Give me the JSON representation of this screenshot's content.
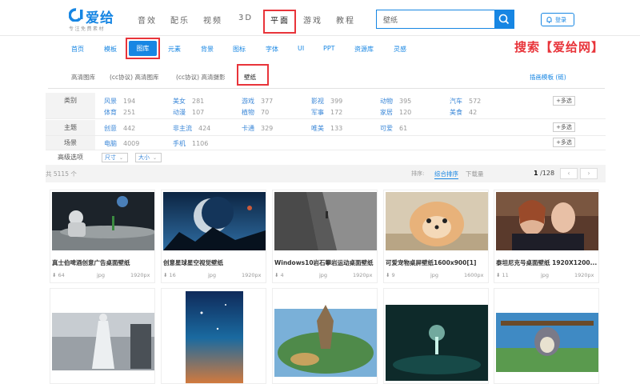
{
  "logo": {
    "text": "爱给",
    "subtitle": "专注免费素材"
  },
  "top_nav": [
    "音效",
    "配乐",
    "视频",
    "3D",
    "平面",
    "游戏",
    "教程"
  ],
  "search": {
    "value": "壁纸"
  },
  "login": {
    "label": "登录"
  },
  "sub_nav": [
    "首页",
    "模板",
    "图库",
    "元素",
    "背景",
    "图标",
    "字体",
    "UI",
    "PPT",
    "资源库",
    "灵感"
  ],
  "promo": "搜索【爱给网】",
  "tabs": [
    "高清图库",
    "(cc协议) 高清图库",
    "(cc协议) 高清摄影",
    "壁纸"
  ],
  "tab_right_link": "插画模板 (链)",
  "filters": {
    "category": {
      "label": "类别",
      "row1": [
        {
          "name": "风景",
          "count": "194"
        },
        {
          "name": "美女",
          "count": "281"
        },
        {
          "name": "游戏",
          "count": "377"
        },
        {
          "name": "影视",
          "count": "399"
        },
        {
          "name": "动物",
          "count": "395"
        },
        {
          "name": "汽车",
          "count": "572"
        }
      ],
      "row2": [
        {
          "name": "体育",
          "count": "251"
        },
        {
          "name": "动漫",
          "count": "107"
        },
        {
          "name": "植物",
          "count": "70"
        },
        {
          "name": "军事",
          "count": "172"
        },
        {
          "name": "家居",
          "count": "120"
        },
        {
          "name": "美食",
          "count": "42"
        }
      ],
      "more": "+多选"
    },
    "theme": {
      "label": "主题",
      "items": [
        {
          "name": "创意",
          "count": "442"
        },
        {
          "name": "非主流",
          "count": "424"
        },
        {
          "name": "卡通",
          "count": "329"
        },
        {
          "name": "唯美",
          "count": "133"
        },
        {
          "name": "可爱",
          "count": "61"
        }
      ],
      "more": "+多选"
    },
    "scene": {
      "label": "场景",
      "items": [
        {
          "name": "电脑",
          "count": "4009"
        },
        {
          "name": "手机",
          "count": "1106"
        }
      ],
      "more": "+多选"
    },
    "advanced": {
      "label": "高级选项",
      "size": "尺寸",
      "scale": "大小"
    }
  },
  "results": {
    "count": "共 5115 个",
    "sort_label": "排序:",
    "sort_active": "综合排序",
    "sort_other": "下载量",
    "page_current": "1",
    "page_total": "/128",
    "prev": "‹",
    "next": "›"
  },
  "cards": [
    {
      "title": "真士伯啤酒创意广告桌面壁纸",
      "downloads": "64",
      "format": "jpg",
      "size": "1920px"
    },
    {
      "title": "创意星球星空视觉壁纸",
      "downloads": "16",
      "format": "jpg",
      "size": "1920px"
    },
    {
      "title": "Windows10岩石攀岩运动桌面壁纸",
      "downloads": "4",
      "format": "jpg",
      "size": "1920px"
    },
    {
      "title": "可爱宠物桌屏壁纸1600x900[1]",
      "downloads": "9",
      "format": "jpg",
      "size": "1600px"
    },
    {
      "title": "泰坦尼克号桌面壁纸 1920X1200...",
      "downloads": "11",
      "format": "jpg",
      "size": "1920px"
    }
  ],
  "colors": {
    "accent": "#1786e3",
    "highlight": "#e8343a"
  }
}
